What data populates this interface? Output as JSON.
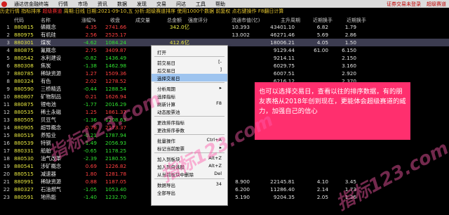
{
  "menubar": {
    "app": "通达信金融终端",
    "items": [
      "行情",
      "市场",
      "资讯",
      "数据",
      "发现",
      "交易",
      "问达",
      "工具",
      "帮助"
    ],
    "right": [
      "证券交易未登录",
      "超级赛道"
    ]
  },
  "titlebar": {
    "left": "历史行情 指标排序",
    "red": "超级赛道",
    "rest": "周期:日线 日期:2021-09-10,五 分析:超级赛道排序 使用1000个数据 前复权 点右键操作 F8翻日计算"
  },
  "columns": [
    "代码",
    "名称",
    "涨幅%",
    "收盘",
    "成交量",
    "总金额",
    "强度评分",
    "流通市值(亿)",
    "主升周期",
    "近期换手",
    "近期换手"
  ],
  "rows": [
    {
      "idx": "1",
      "code": "880815",
      "name": "磷概念",
      "chg": "4.35",
      "dir": "up",
      "price": "2741.66",
      "amt": "342.0亿",
      "r1": "10.393",
      "r2": "43401.10",
      "r3": "6.82",
      "r4": "1.79"
    },
    {
      "idx": "2",
      "code": "880975",
      "name": "有机硅",
      "chg": "2.56",
      "dir": "up",
      "price": "2525.17",
      "amt": "",
      "r1": "13.002",
      "r2": "46271.46",
      "r3": "5.69",
      "r4": "2.86"
    },
    {
      "idx": "3",
      "code": "880301",
      "name": "煤炭",
      "chg": "-4.62",
      "dir": "dn",
      "price": "1084.24",
      "amt": "412.6亿",
      "r1": "",
      "r2": "18006.21",
      "r3": "4.05",
      "r4": "1.50"
    },
    {
      "idx": "4",
      "code": "880875",
      "name": "氟概念",
      "chg": "2.75",
      "dir": "up",
      "price": "3409.87",
      "amt": "",
      "r1": "",
      "r2": "9129.44",
      "r3": "61.00",
      "r4": "6.150"
    },
    {
      "idx": "5",
      "code": "880542",
      "name": "水利建设",
      "chg": "-0.82",
      "dir": "dn",
      "price": "1436.49",
      "amt": "",
      "r1": "",
      "r2": "9214.11",
      "r3": "",
      "r4": "2.150"
    },
    {
      "idx": "6",
      "code": "880308",
      "name": "焦炭",
      "chg": "-1.38",
      "dir": "dn",
      "price": "1462.98",
      "amt": "",
      "r1": "",
      "r2": "6029.75",
      "r3": "",
      "r4": "3.160"
    },
    {
      "idx": "7",
      "code": "880785",
      "name": "稀缺资源",
      "chg": "1.27",
      "dir": "up",
      "price": "1509.36",
      "amt": "",
      "r1": "",
      "r2": "6007.51",
      "r3": "",
      "r4": "2.920"
    },
    {
      "idx": "8",
      "code": "880324",
      "name": "有色",
      "chg": "2.02",
      "dir": "up",
      "price": "1278.52",
      "amt": "",
      "r1": "",
      "r2": "6216.12",
      "r3": "",
      "r4": "2.370"
    },
    {
      "idx": "9",
      "code": "880590",
      "name": "三桥精选",
      "chg": "-0.44",
      "dir": "dn",
      "price": "1288.54",
      "amt": "",
      "r1": "",
      "r2": "",
      "r3": "",
      "r4": ""
    },
    {
      "idx": "10",
      "code": "880807",
      "name": "矿物制品",
      "chg": "0.21",
      "dir": "up",
      "price": "1626.94",
      "amt": "",
      "r1": "",
      "r2": "",
      "r3": "",
      "r4": ""
    },
    {
      "idx": "11",
      "code": "880875",
      "name": "锂电池",
      "chg": "-1.77",
      "dir": "dn",
      "price": "2016.29",
      "amt": "",
      "r1": "",
      "r2": "",
      "r3": "",
      "r4": ""
    },
    {
      "idx": "12",
      "code": "880535",
      "name": "稀土永磁",
      "chg": "1.25",
      "dir": "up",
      "price": "1861.37",
      "amt": "",
      "r1": "",
      "r2": "",
      "r3": "",
      "r4": ""
    },
    {
      "idx": "13",
      "code": "880505",
      "name": "贝豆气",
      "chg": "-1.36",
      "dir": "dn",
      "price": "1208.63",
      "amt": "",
      "r1": "",
      "r2": "",
      "r3": "",
      "r4": ""
    },
    {
      "idx": "14",
      "code": "880905",
      "name": "超导概念",
      "chg": "0.78",
      "dir": "up",
      "price": "2173.37",
      "amt": "",
      "r1": "",
      "r2": "",
      "r3": "",
      "r4": ""
    },
    {
      "idx": "15",
      "code": "880519",
      "name": "养殖业",
      "chg": "-0.21",
      "dir": "dn",
      "price": "1787.94",
      "amt": "",
      "r1": "",
      "r2": "",
      "r3": "",
      "r4": ""
    },
    {
      "idx": "16",
      "code": "880539",
      "name": "特钢",
      "chg": "-1.49",
      "dir": "dn",
      "price": "2056.93",
      "amt": "",
      "r1": "",
      "r2": "",
      "r3": "",
      "r4": ""
    },
    {
      "idx": "17",
      "code": "880331",
      "name": "船舶",
      "chg": "-0.65",
      "dir": "dn",
      "price": "1178.25",
      "amt": "",
      "r1": "",
      "r2": "",
      "r3": "",
      "r4": ""
    },
    {
      "idx": "18",
      "code": "880530",
      "name": "油气改革",
      "chg": "-2.39",
      "dir": "dn",
      "price": "2180.55",
      "amt": "",
      "r1": "",
      "r2": "",
      "r3": "",
      "r4": ""
    },
    {
      "idx": "19",
      "code": "880541",
      "name": "涉矿概念",
      "chg": "0.69",
      "dir": "up",
      "price": "1226.82",
      "amt": "",
      "r1": "",
      "r2": "",
      "r3": "",
      "r4": ""
    },
    {
      "idx": "20",
      "code": "880515",
      "name": "减速器",
      "chg": "1.80",
      "dir": "up",
      "price": "1281.78",
      "amt": "",
      "r1": "",
      "r2": "",
      "r3": "",
      "r4": ""
    },
    {
      "idx": "21",
      "code": "880991",
      "name": "稀缺资源",
      "chg": "0.88",
      "dir": "up",
      "price": "1187.05",
      "amt": "",
      "r1": "8.900",
      "r2": "22145.81",
      "r3": "4.10",
      "r4": "3.45"
    },
    {
      "idx": "22",
      "code": "880327",
      "name": "石油燃气",
      "chg": "-1.05",
      "dir": "dn",
      "price": "1053.40",
      "amt": "",
      "r1": "6.200",
      "r2": "11286.40",
      "r3": "2.14",
      "r4": "1.73"
    },
    {
      "idx": "23",
      "code": "880591",
      "name": "地热能",
      "chg": "-1.40",
      "dir": "dn",
      "price": "1232.70",
      "amt": "",
      "r1": "5.190",
      "r2": "9204.35",
      "r3": "2.05",
      "r4": "1.36"
    }
  ],
  "amt_tail": [
    "56.2亿",
    "71.5亿",
    "98.5亿"
  ],
  "context_menu": {
    "items": [
      {
        "label": "打开",
        "key": ""
      },
      {
        "label": "前交易日",
        "key": "[-"
      },
      {
        "label": "后交易日",
        "key": "]"
      },
      {
        "label": "选择交易日",
        "key": ""
      },
      {
        "label": "分析周期",
        "key": "▸"
      },
      {
        "label": "选择指标",
        "key": ""
      },
      {
        "label": "刷新计算",
        "key": "F8"
      },
      {
        "label": "动态股票池",
        "key": ""
      },
      {
        "label": "更改排序指标",
        "key": ""
      },
      {
        "label": "更改排序参数",
        "key": ""
      },
      {
        "label": "批量操作",
        "key": "Ctrl+A"
      },
      {
        "label": "标记当前股票",
        "key": "▸"
      },
      {
        "label": "加入到板块",
        "key": "Alt+Z"
      },
      {
        "label": "加入到自选股",
        "key": "Alt+Z"
      },
      {
        "label": "从当前板块中删除",
        "key": "Del"
      },
      {
        "label": "数据导出",
        "key": "34"
      },
      {
        "label": "全部导出",
        "key": ""
      }
    ]
  },
  "callout": "也可以选择交易日，查看以往的排序数据，有的朋友表格从2018年创到现在，更能体会超级赛道的威力，加强自己的信心",
  "watermark": "指标123.com"
}
